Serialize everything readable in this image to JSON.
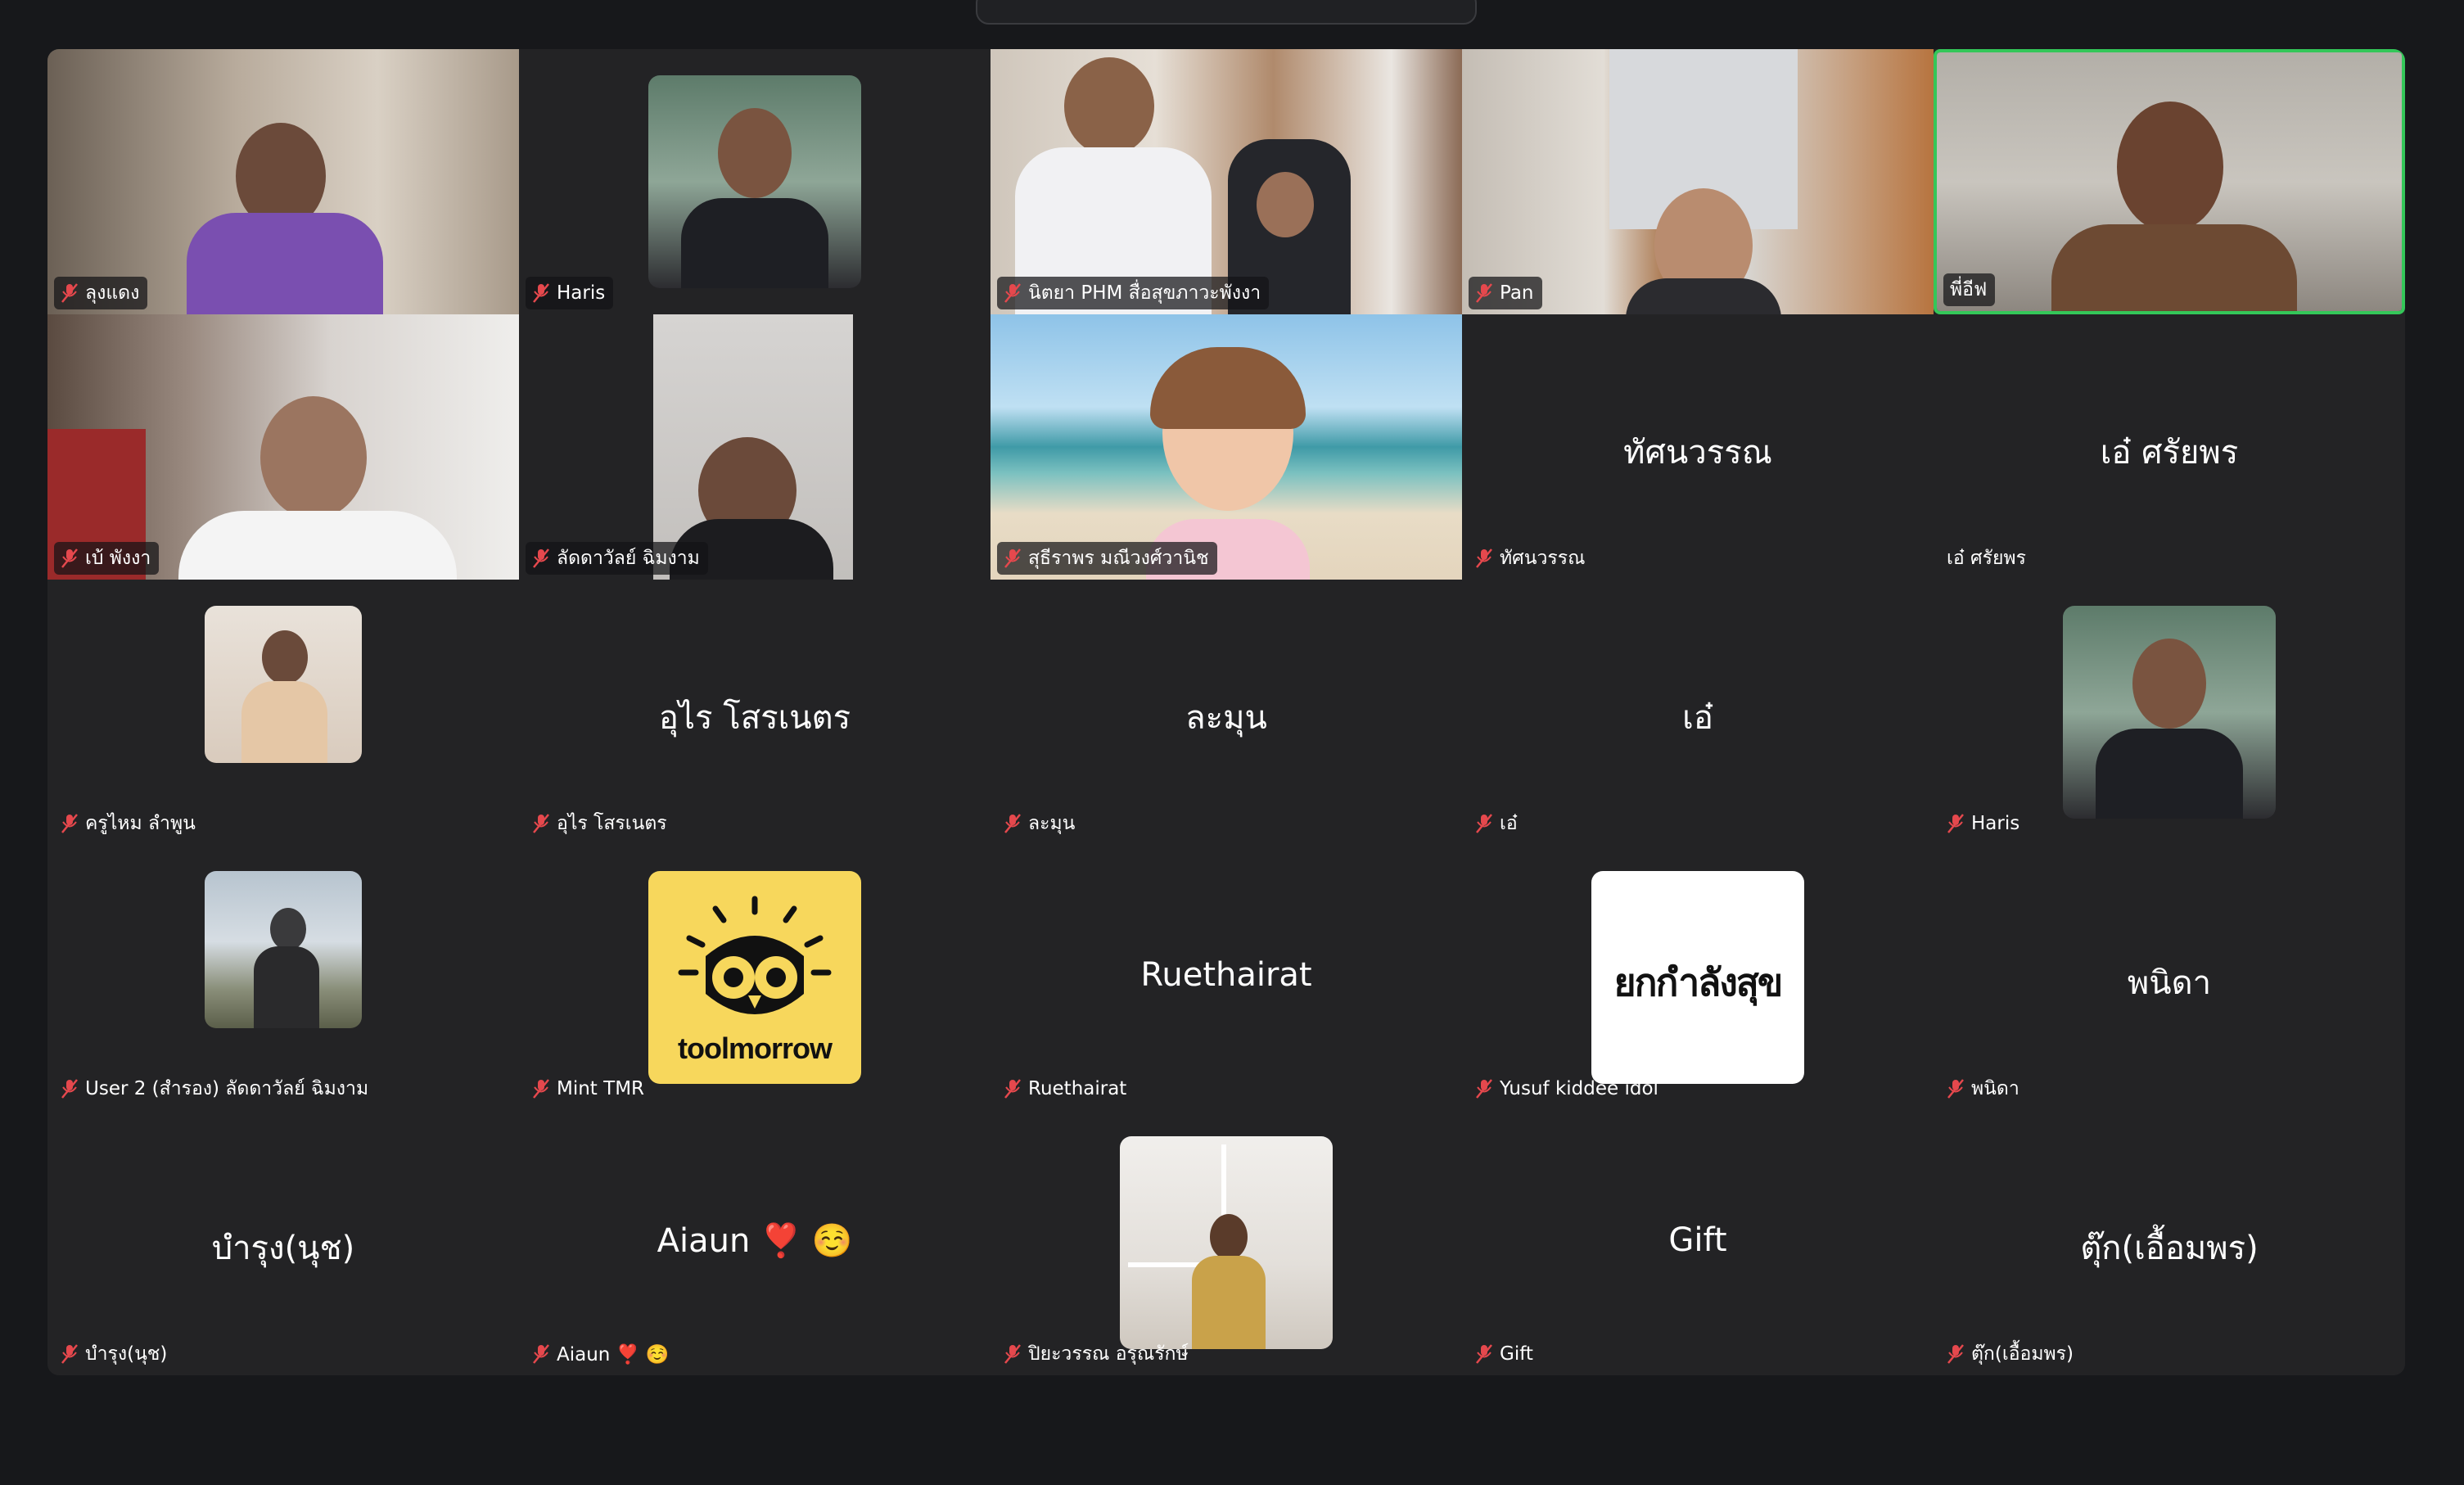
{
  "meeting": {
    "active_speaker_color": "#34c759",
    "mute_icon_color": "#e5484d"
  },
  "participants": [
    {
      "name": "ลุงแดง",
      "display": "",
      "type": "video"
    },
    {
      "name": "Haris",
      "display": "",
      "type": "avatar"
    },
    {
      "name": "นิตยา PHM สื่อสุขภาวะพังงา",
      "display": "",
      "type": "video"
    },
    {
      "name": "Pan",
      "display": "",
      "type": "video"
    },
    {
      "name": "พี่อีฟ",
      "display": "",
      "type": "video",
      "active": true
    },
    {
      "name": "เบ้ พังงา",
      "display": "",
      "type": "video"
    },
    {
      "name": "ลัดดาวัลย์ ฉิมงาม",
      "display": "",
      "type": "video"
    },
    {
      "name": "สุธีราพร มณีวงศ์วานิช",
      "display": "",
      "type": "video"
    },
    {
      "name": "ทัศนวรรณ",
      "display": "ทัศนวรรณ",
      "type": "text"
    },
    {
      "name": "เอ๋ ศรัยพร",
      "display": "เอ๋ ศรัยพร",
      "type": "text"
    },
    {
      "name": "ครูไหม ลำพูน",
      "display": "",
      "type": "avatar"
    },
    {
      "name": "อุไร  โสรเนตร",
      "display": "อุไร  โสรเนตร",
      "type": "text"
    },
    {
      "name": "ละมุน",
      "display": "ละมุน",
      "type": "text"
    },
    {
      "name": "เอ๋",
      "display": "เอ๋",
      "type": "text"
    },
    {
      "name": "Haris",
      "display": "",
      "type": "avatar"
    },
    {
      "name": "User 2 (สำรอง) ลัดดาวัลย์ ฉิมงาม",
      "display": "",
      "type": "avatar"
    },
    {
      "name": "Mint TMR",
      "display": "",
      "type": "avatar",
      "logo_text": "toolmorrow"
    },
    {
      "name": "Ruethairat",
      "display": "Ruethairat",
      "type": "text"
    },
    {
      "name": "Yusuf kiddee idol",
      "display": "",
      "type": "avatar",
      "logo_text": "ยกกำลังสุข"
    },
    {
      "name": "พนิดา",
      "display": "พนิดา",
      "type": "text"
    },
    {
      "name": "บำรุง(นุช)",
      "display": "บำรุง(นุช)",
      "type": "text"
    },
    {
      "name": "Aiaun ❣️ ☺️",
      "display": "Aiaun ❣️ ☺️",
      "type": "text"
    },
    {
      "name": "ปิยะวรรณ อรุณรักษ์",
      "display": "",
      "type": "avatar"
    },
    {
      "name": "Gift",
      "display": "Gift",
      "type": "text"
    },
    {
      "name": "ตุ๊ก(เอื้อมพร)",
      "display": "ตุ๊ก(เอื้อมพร)",
      "type": "text"
    }
  ]
}
